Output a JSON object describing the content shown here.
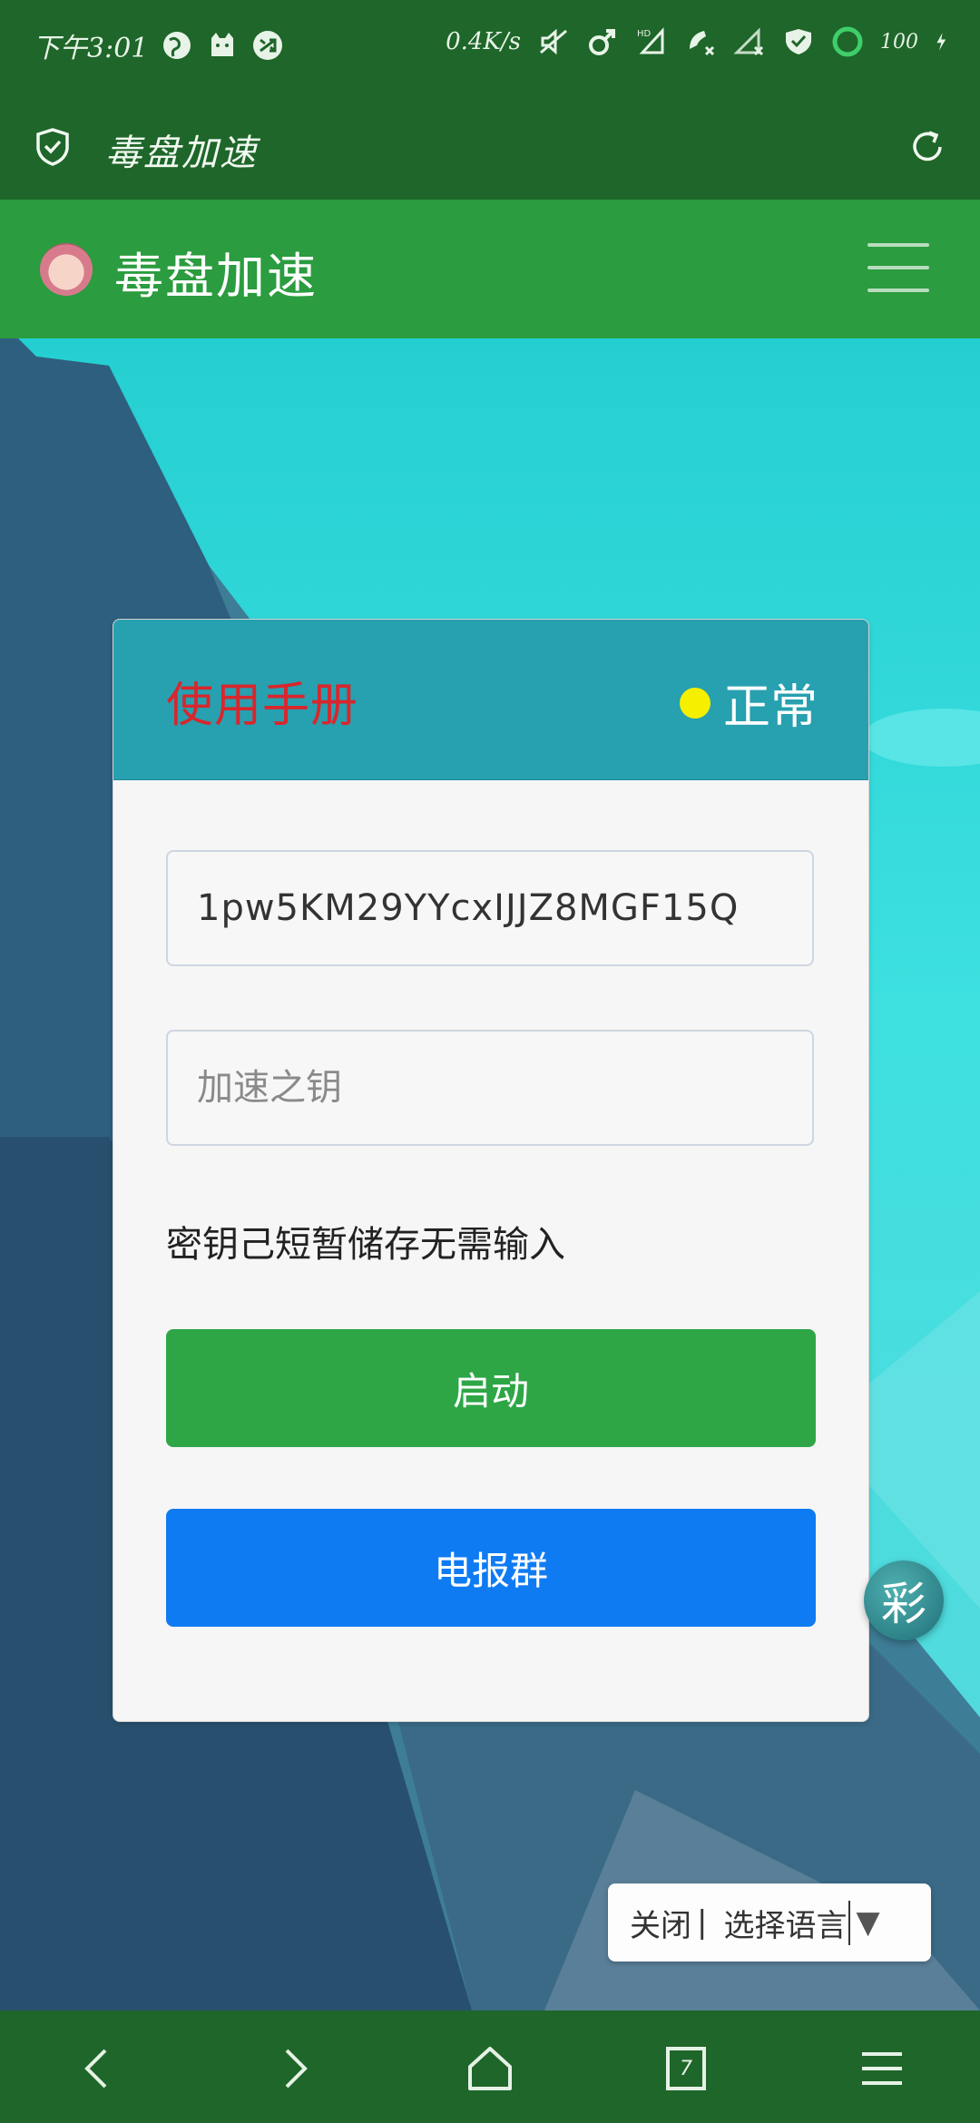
{
  "status_bar": {
    "time": "下午3:01",
    "net_speed": "0.4K/s",
    "battery": "100",
    "icons": [
      "vpn-globe-icon",
      "cat-icon",
      "shuffle-icon",
      "mute-icon",
      "male-icon",
      "hd-signal-icon",
      "no-call-icon",
      "no-signal-icon",
      "shield-check-icon",
      "circle-icon",
      "charging-icon"
    ]
  },
  "browser": {
    "title": "毒盘加速",
    "icons": [
      "shield-check-icon",
      "refresh-icon"
    ]
  },
  "site_header": {
    "title": "毒盘加速",
    "icons": [
      "avatar",
      "hamburger-menu-icon"
    ]
  },
  "card": {
    "manual_link": "使用手册",
    "status_text": "正常",
    "status_color": "#f5f000",
    "key_input_value": "1pw5KM29YYcxIJJZ8MGF15Q",
    "key_input_placeholder": "加速之钥",
    "hint": "密钥己短暂储存无需输入",
    "start_button": "启动",
    "telegram_button": "电报群"
  },
  "float_button": "彩",
  "language_bar": {
    "close": "关闭",
    "separator": "|",
    "select": "选择语言",
    "arrow": "▼"
  },
  "bottom_nav": {
    "tabs_count": "7",
    "icons": [
      "back-icon",
      "forward-icon",
      "home-icon",
      "tabs-icon",
      "menu-icon"
    ]
  },
  "colors": {
    "status_bar_bg": "#1e6629",
    "site_header_bg": "#2b9c3f",
    "card_header_bg": "#27a0b0",
    "manual_link": "#d9262c",
    "start_button": "#2ea646",
    "telegram_button": "#0f7bf3"
  }
}
